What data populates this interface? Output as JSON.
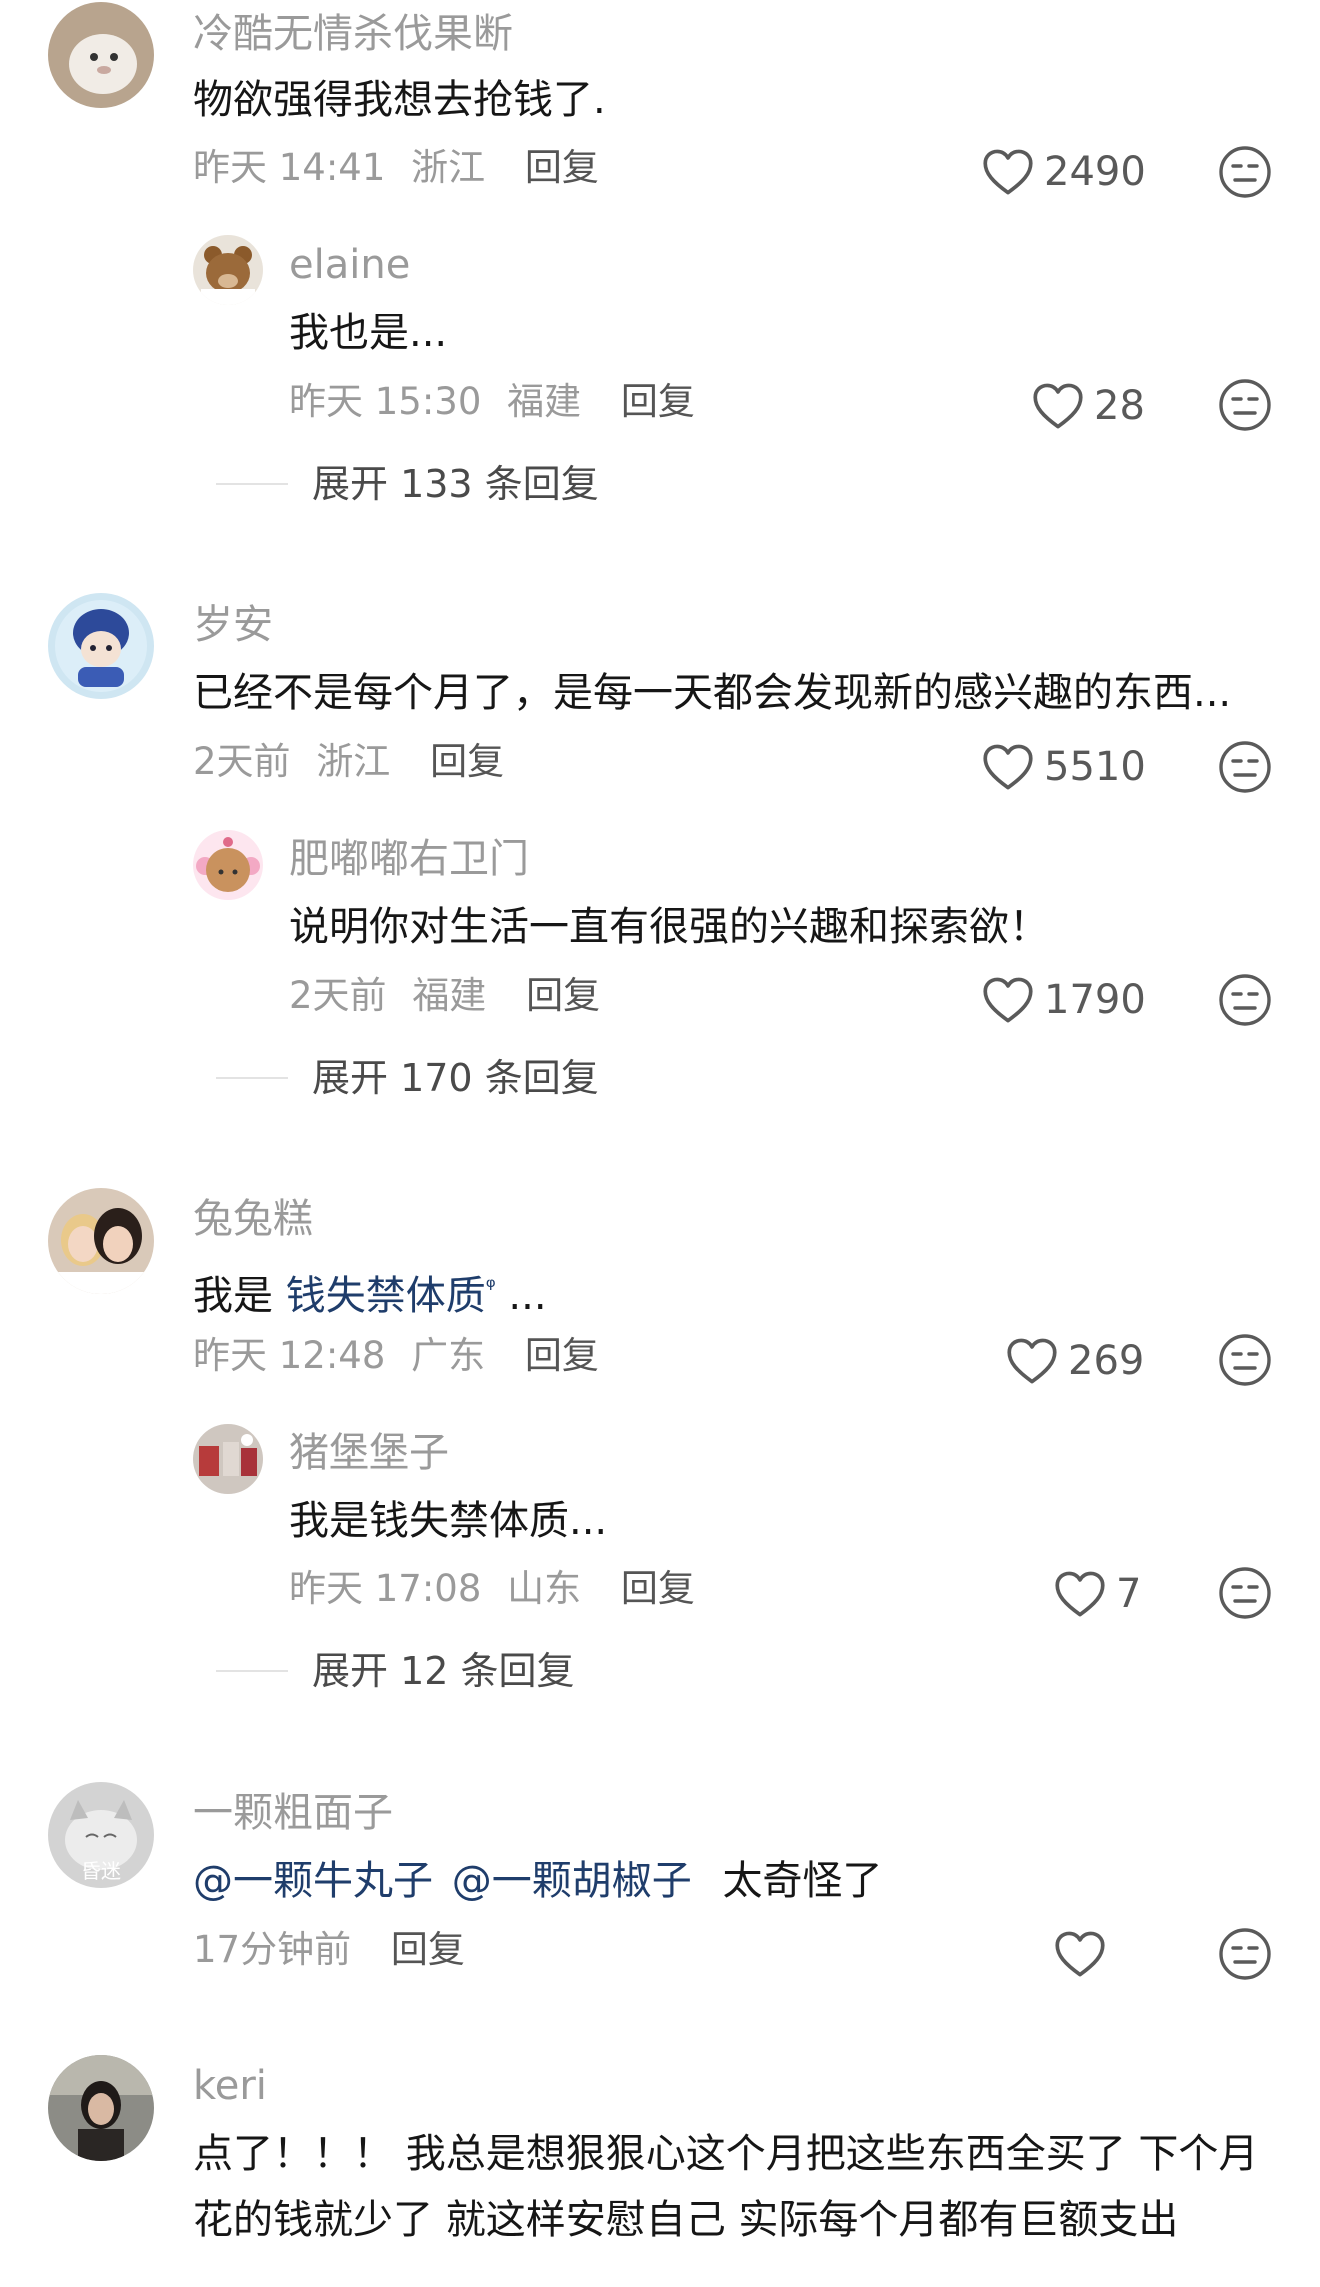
{
  "comments": [
    {
      "user": "冷酷无情杀伐果断",
      "text": "物欲强得我想去抢钱了.",
      "time": "昨天 14:41",
      "location": "浙江",
      "reply_label": "回复",
      "likes": "2490",
      "reply": {
        "user": "elaine",
        "text": "我也是...",
        "time": "昨天 15:30",
        "location": "福建",
        "reply_label": "回复",
        "likes": "28"
      },
      "expand": "展开 133 条回复"
    },
    {
      "user": "岁安",
      "text": "已经不是每个月了，是每一天都会发现新的感兴趣的东西...",
      "time": "2天前",
      "location": "浙江",
      "reply_label": "回复",
      "likes": "5510",
      "reply": {
        "user": "肥嘟嘟右卫门",
        "text": "说明你对生活一直有很强的兴趣和探索欲！",
        "time": "2天前",
        "location": "福建",
        "reply_label": "回复",
        "likes": "1790"
      },
      "expand": "展开 170 条回复"
    },
    {
      "user": "兔兔糕",
      "text_prefix": "我是 ",
      "text_link": "钱失禁体质",
      "text_suffix": " ...",
      "time": "昨天 12:48",
      "location": "广东",
      "reply_label": "回复",
      "likes": "269",
      "reply": {
        "user": "猪堡堡子",
        "text": "我是钱失禁体质...",
        "time": "昨天 17:08",
        "location": "山东",
        "reply_label": "回复",
        "likes": "7"
      },
      "expand": "展开 12 条回复"
    },
    {
      "user": "一颗粗面子",
      "mention1": "@一颗牛丸子",
      "mention2": "@一颗胡椒子",
      "text_suffix": "太奇怪了",
      "time": "17分钟前",
      "reply_label": "回复",
      "avatar_caption": "昏迷"
    },
    {
      "user": "keri",
      "text_line1": "点了！！！ 我总是想狠狠心这个月把这些东西全买了 下个月",
      "text_line2": "花的钱就少了 就这样安慰自己 实际每个月都有巨额支出"
    }
  ],
  "icons": {
    "like": "heart-outline-icon",
    "dislike": "meh-face-icon",
    "search_hint": "search-icon"
  },
  "colors": {
    "link": "#1f3d6b",
    "secondary_text": "#9a9a9a"
  }
}
